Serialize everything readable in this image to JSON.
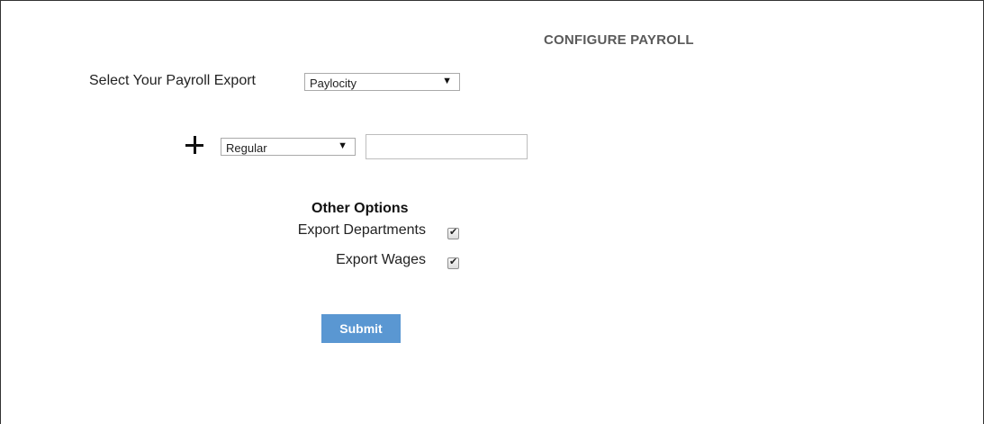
{
  "page": {
    "title": "CONFIGURE PAYROLL"
  },
  "export": {
    "label": "Select Your Payroll Export",
    "selected": "Paylocity"
  },
  "earnings_row": {
    "add_icon": "plus-icon",
    "pay_type_selected": "Regular",
    "amount_value": ""
  },
  "other_options": {
    "heading": "Other Options",
    "items": [
      {
        "label": "Export Departments",
        "checked": true
      },
      {
        "label": "Export Wages",
        "checked": true
      }
    ]
  },
  "submit": {
    "label": "Submit"
  },
  "colors": {
    "submit_bg": "#5a97d2",
    "title_text": "#5a5a5a"
  }
}
